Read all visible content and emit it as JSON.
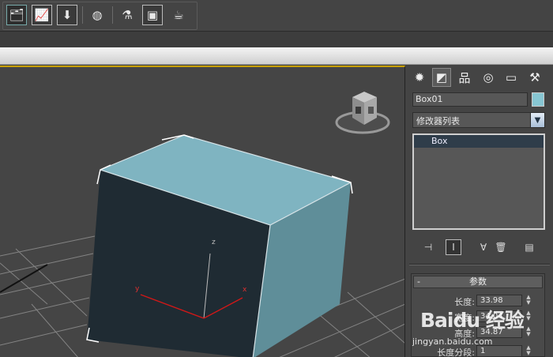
{
  "toolbar": {
    "buttons": [
      {
        "name": "open-explorer-icon",
        "glyph": "🗂"
      },
      {
        "name": "curve-editor-icon",
        "glyph": "📈"
      },
      {
        "name": "save-scene-icon",
        "glyph": "⬇"
      },
      {
        "name": "material-editor-icon",
        "glyph": "◍"
      },
      {
        "name": "render-setup-icon",
        "glyph": "⚗"
      },
      {
        "name": "rendered-frame-icon",
        "glyph": "▣"
      },
      {
        "name": "render-production-icon",
        "glyph": "☕"
      }
    ]
  },
  "panel": {
    "tabs": [
      {
        "name": "create-tab-icon",
        "glyph": "✹"
      },
      {
        "name": "modify-tab-icon",
        "glyph": "◩"
      },
      {
        "name": "hierarchy-tab-icon",
        "glyph": "品"
      },
      {
        "name": "motion-tab-icon",
        "glyph": "◎"
      },
      {
        "name": "display-tab-icon",
        "glyph": "▭"
      },
      {
        "name": "utilities-tab-icon",
        "glyph": "⚒"
      }
    ],
    "object_name": "Box01",
    "object_color": "#87c6d2",
    "modifier_list_label": "修改器列表",
    "stack": [
      {
        "label": "Box"
      }
    ],
    "stack_tools": [
      {
        "name": "pin-stack-icon",
        "glyph": "⊣"
      },
      {
        "name": "show-end-result-icon",
        "glyph": "Ⅰ"
      },
      {
        "name": "make-unique-icon",
        "glyph": "∀"
      },
      {
        "name": "remove-modifier-icon",
        "glyph": "🗑"
      },
      {
        "name": "configure-sets-icon",
        "glyph": "▤"
      }
    ],
    "rollout": {
      "title": "参数",
      "collapse": "-",
      "params": [
        {
          "label": "长度:",
          "value": "33.98"
        },
        {
          "label": "宽度:",
          "value": "34.04"
        },
        {
          "label": "高度:",
          "value": "34.87"
        },
        {
          "label": "长度分段:",
          "value": "1"
        }
      ]
    }
  },
  "viewport": {
    "axis_x": "x",
    "axis_y": "y",
    "axis_z": "z",
    "cube_top_color": "#7fb4c1",
    "cube_front_color": "#1f2b33",
    "cube_side_color": "#5f8e99",
    "grid_color": "#8a8a8a"
  },
  "watermark": {
    "brand": "Baidu 经验",
    "url": "jingyan.baidu.com"
  }
}
